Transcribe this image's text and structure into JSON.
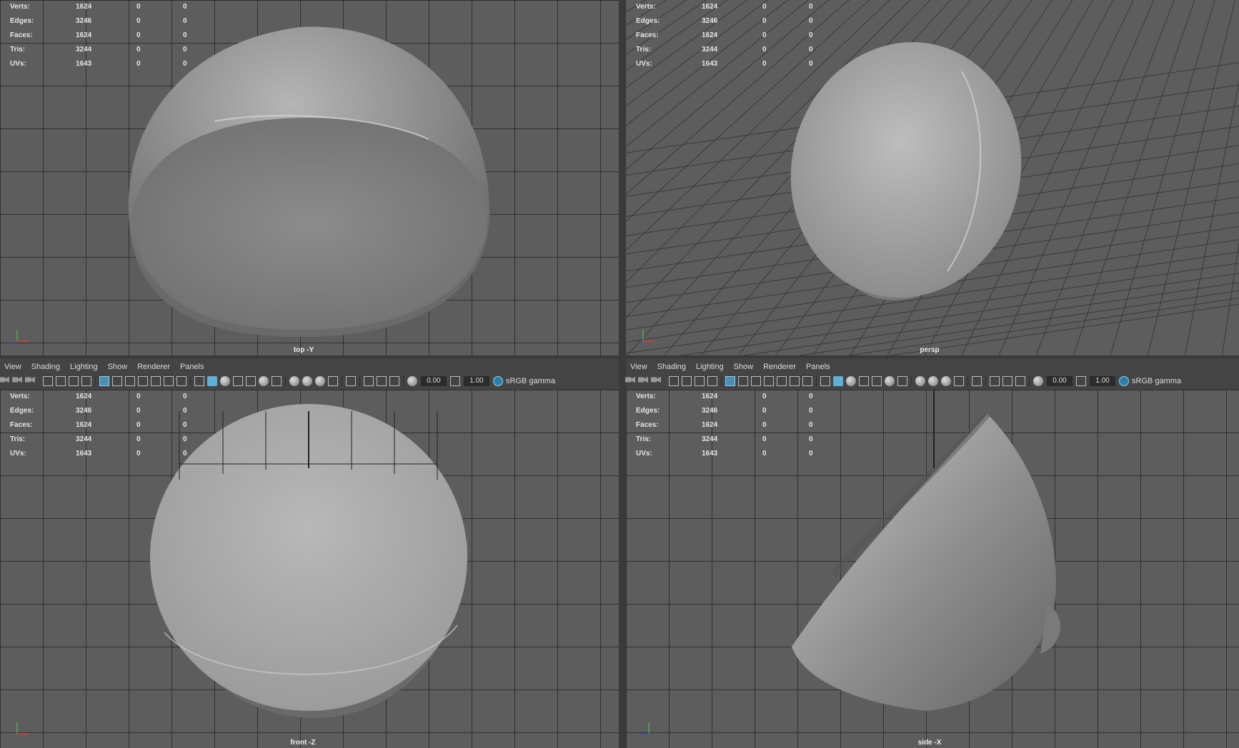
{
  "hud_stats": [
    {
      "label": "Verts:",
      "v1": "1624",
      "v2": "0",
      "v3": "0"
    },
    {
      "label": "Edges:",
      "v1": "3246",
      "v2": "0",
      "v3": "0"
    },
    {
      "label": "Faces:",
      "v1": "1624",
      "v2": "0",
      "v3": "0"
    },
    {
      "label": "Tris:",
      "v1": "3244",
      "v2": "0",
      "v3": "0"
    },
    {
      "label": "UVs:",
      "v1": "1643",
      "v2": "0",
      "v3": "0"
    }
  ],
  "viewports": {
    "top": {
      "camera_label": "top -Y"
    },
    "persp": {
      "camera_label": "persp"
    },
    "front": {
      "camera_label": "front -Z"
    },
    "side": {
      "camera_label": "side -X"
    }
  },
  "menu": {
    "items": [
      "View",
      "Shading",
      "Lighting",
      "Show",
      "Renderer",
      "Panels"
    ]
  },
  "toolbar": {
    "exposure": "0.00",
    "gamma": "1.00",
    "color_space": "sRGB gamma"
  },
  "colors": {
    "viewport_bg": "#5d5d5d",
    "grid_line": "#282828",
    "panel_bg": "#444444",
    "accent": "#5fb0d8"
  }
}
